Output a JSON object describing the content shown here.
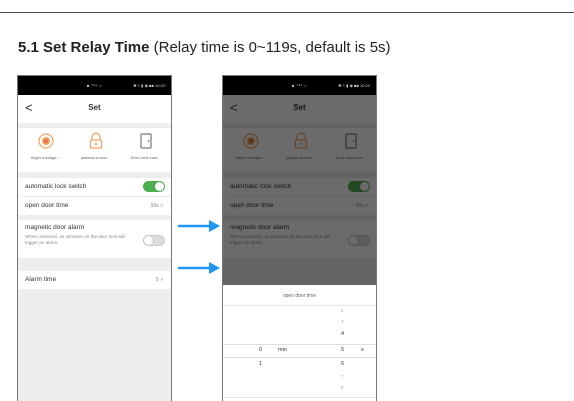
{
  "section": {
    "number_title": "5.1 Set Relay Time",
    "note": "(Relay time is 0~119s, default is 5s)"
  },
  "status_bar": {
    "center": "■ ᵀᴬᴸ ≈",
    "right": "✱ ≡ ▮ ◉ ■■ 10:20"
  },
  "screen": {
    "back": "<",
    "title": "Set",
    "icons": [
      {
        "label": "finger manage...",
        "icon": "fingerprint-icon"
      },
      {
        "label": "password man...",
        "icon": "lock-icon"
      },
      {
        "label": "Door card man...",
        "icon": "door-card-icon"
      }
    ],
    "auto_lock": {
      "label": "automatic lock switch",
      "on": true
    },
    "open_door_time": {
      "label": "open door time",
      "value": "99s >"
    },
    "magnetic_alarm": {
      "label": "magnetic door alarm",
      "description": "When unlocked, an intrusion on the door lock will trigger an alarm",
      "on": false
    },
    "alarm_time": {
      "label": "Alarm time",
      "value": "5 >"
    }
  },
  "picker": {
    "title": "open door time",
    "minutes": {
      "value": "0",
      "unit": "min",
      "below": "1"
    },
    "seconds": {
      "above": [
        "2",
        "3",
        "4"
      ],
      "value": "5",
      "unit": "s",
      "below": [
        "6",
        "7",
        "8"
      ]
    }
  },
  "colors": {
    "toggle_on": "#4caf50",
    "arrow": "#2196f3"
  }
}
